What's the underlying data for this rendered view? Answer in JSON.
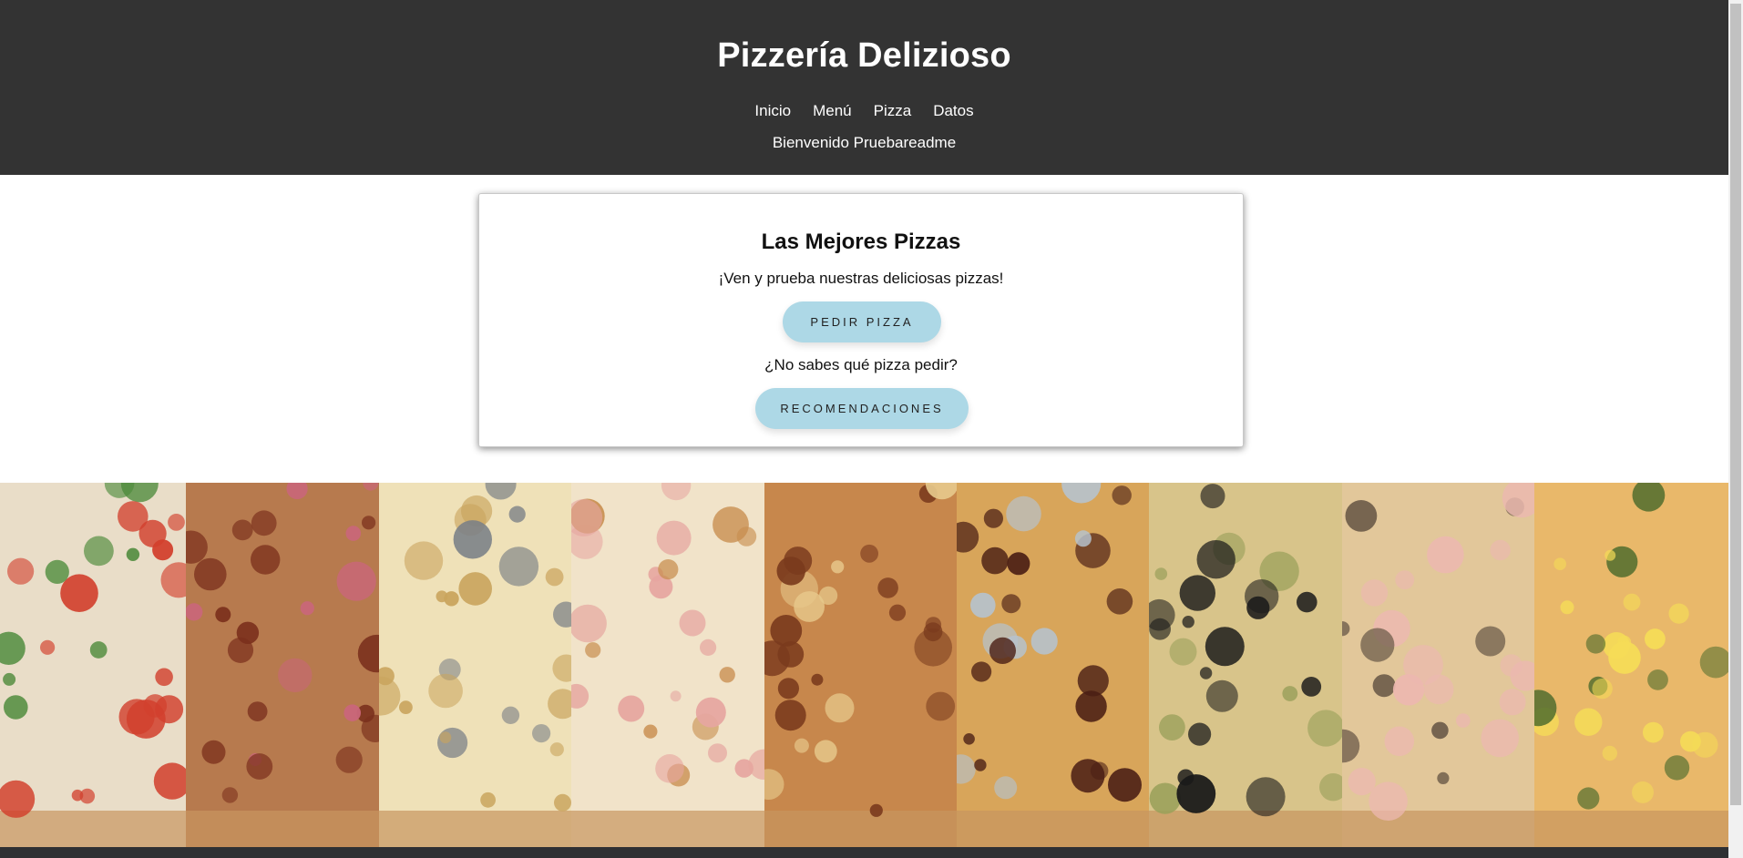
{
  "header": {
    "title": "Pizzería Delizioso",
    "nav": [
      "Inicio",
      "Menú",
      "Pizza",
      "Datos"
    ],
    "welcome": "Bienvenido Pruebareadme"
  },
  "hero": {
    "title": "Las Mejores Pizzas",
    "subtitle": "¡Ven y prueba nuestras deliciosas pizzas!",
    "order_button": "PEDIR PIZZA",
    "question": "¿No sabes qué pizza pedir?",
    "recommend_button": "RECOMENDACIONES"
  },
  "gallery": {
    "tiles": [
      {
        "name": "margherita-pizza-image",
        "base": "#e9ddc8",
        "accent": "#d2402d",
        "accent2": "#4c8a3a"
      },
      {
        "name": "bbq-chicken-pizza-image",
        "base": "#b77a4e",
        "accent": "#7a2f1c",
        "accent2": "#c9667a"
      },
      {
        "name": "four-cheese-pizza-image",
        "base": "#efe1b8",
        "accent": "#c9a45d",
        "accent2": "#7a7f86"
      },
      {
        "name": "ham-cheese-pizza-image",
        "base": "#f1e3c9",
        "accent": "#e6a6a0",
        "accent2": "#c88d4e"
      },
      {
        "name": "meat-onion-pizza-image",
        "base": "#c7874c",
        "accent": "#7a3a1d",
        "accent2": "#e7c98c"
      },
      {
        "name": "pepperoni-pizza-image",
        "base": "#d8a55a",
        "accent": "#4a1e14",
        "accent2": "#b6c2cc"
      },
      {
        "name": "olive-mushroom-pizza-image",
        "base": "#d8c48a",
        "accent": "#1a1a1a",
        "accent2": "#9aa05a"
      },
      {
        "name": "ham-mushroom-pizza-image",
        "base": "#e2c79a",
        "accent": "#ecb8b0",
        "accent2": "#6b5a48"
      },
      {
        "name": "hawaiian-pizza-image",
        "base": "#e9b86a",
        "accent": "#f5dc57",
        "accent2": "#4d6b2c"
      }
    ]
  },
  "colors": {
    "header_bg": "#333333",
    "button_bg": "#add8e6"
  }
}
